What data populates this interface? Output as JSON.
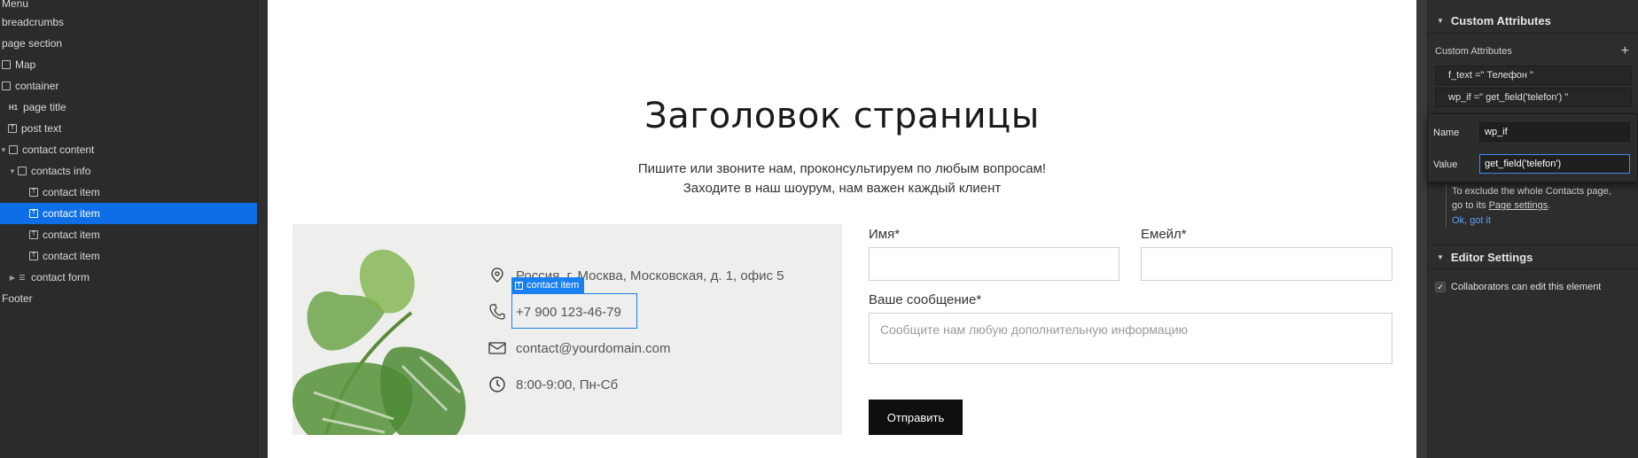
{
  "navigator": {
    "items": [
      {
        "label": "Menu"
      },
      {
        "label": "breadcrumbs"
      },
      {
        "label": "page section"
      },
      {
        "label": "Map"
      },
      {
        "label": "container"
      },
      {
        "label": "page title"
      },
      {
        "label": "post text"
      },
      {
        "label": "contact content"
      },
      {
        "label": "contacts info"
      },
      {
        "label": "contact item"
      },
      {
        "label": "contact item"
      },
      {
        "label": "contact item"
      },
      {
        "label": "contact item"
      },
      {
        "label": "contact form"
      },
      {
        "label": "Footer"
      }
    ],
    "selected_index": 10
  },
  "page": {
    "title": "Заголовок страницы",
    "subtitle_line1": "Пишите или звоните нам, проконсультируем по любым вопросам!",
    "subtitle_line2": "Заходите в наш шоурум, нам важен каждый клиент",
    "contacts": {
      "address": "Россия, г. Москва, Московская, д. 1, офис 5",
      "phone": "+7 900 123-46-79",
      "email": "contact@yourdomain.com",
      "hours": "8:00-9:00, Пн-Сб"
    },
    "selection_tag": "contact item",
    "form": {
      "name_label": "Имя*",
      "email_label": "Емейл*",
      "message_label": "Ваше сообщение*",
      "message_placeholder": "Сообщите нам любую дополнительную информацию",
      "submit_label": "Отправить"
    }
  },
  "settings": {
    "custom_attributes_title": "Custom Attributes",
    "custom_attributes_label": "Custom Attributes",
    "attributes": [
      "f_text =\" Телефон \"",
      "wp_if =\" get_field('telefon') \""
    ],
    "popup": {
      "name_label": "Name",
      "name_value": "wp_if",
      "value_label": "Value",
      "value_value": "get_field('telefon')"
    },
    "note": {
      "text1": "To exclude the whole Contacts page,",
      "text2": "go to its ",
      "link": "Page settings",
      "text3": ".",
      "ok": "Ok, got it"
    },
    "editor_settings_title": "Editor Settings",
    "collaborators_label": "Collaborators can edit this element"
  },
  "colors": {
    "selection": "#0d6ee6",
    "panel_bg": "#2b2b2b",
    "button_bg": "#0f0f0f"
  }
}
